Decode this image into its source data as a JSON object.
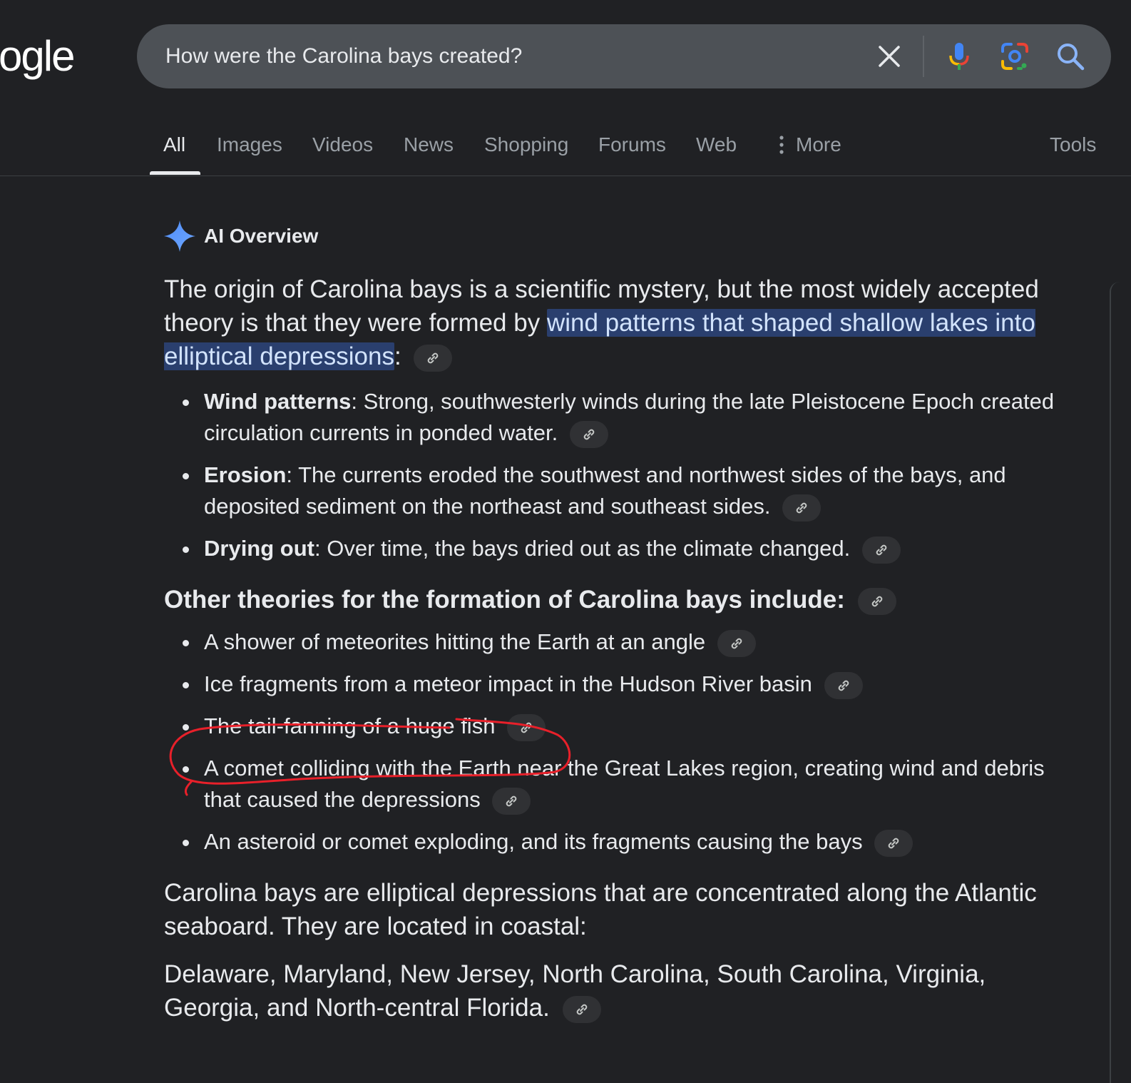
{
  "logo": {
    "text": "ogle"
  },
  "search": {
    "query": "How were the Carolina bays created?"
  },
  "tabs": [
    {
      "label": "All"
    },
    {
      "label": "Images"
    },
    {
      "label": "Videos"
    },
    {
      "label": "News"
    },
    {
      "label": "Shopping"
    },
    {
      "label": "Forums"
    },
    {
      "label": "Web"
    },
    {
      "label": "More"
    }
  ],
  "tools_label": "Tools",
  "ai_overview": {
    "title": "AI Overview",
    "intro_before": "The origin of Carolina bays is a scientific mystery, but the most widely accepted theory is that they were formed by ",
    "intro_highlight": "wind patterns that shaped shallow lakes into elliptical depressions",
    "intro_after": ":",
    "main_bullets": [
      {
        "term": "Wind patterns",
        "text": ": Strong, southwesterly winds during the late Pleistocene Epoch created circulation currents in ponded water."
      },
      {
        "term": "Erosion",
        "text": ": The currents eroded the southwest and northwest sides of the bays, and deposited sediment on the northeast and southeast sides."
      },
      {
        "term": "Drying out",
        "text": ": Over time, the bays dried out as the climate changed."
      }
    ],
    "other_heading": "Other theories for the formation of Carolina bays include:",
    "other_bullets": [
      "A shower of meteorites hitting the Earth at an angle",
      "Ice fragments from a meteor impact in the Hudson River basin",
      "The tail-fanning of a huge fish",
      "A comet colliding with the Earth near the Great Lakes region, creating wind and debris that caused the depressions",
      "An asteroid or comet exploding, and its fragments causing the bays"
    ],
    "location_para": "Carolina bays are elliptical depressions that are concentrated along the Atlantic seaboard. They are located in coastal:",
    "states_para": "Delaware, Maryland, New Jersey, North Carolina, South Carolina, Virginia, Georgia, and North-central Florida."
  },
  "colors": {
    "background": "#202124",
    "searchbar": "#4d5156",
    "highlight": "#2a3f6e",
    "annotation": "#e8202a"
  },
  "icons": [
    "clear-icon",
    "microphone-icon",
    "lens-icon",
    "search-icon",
    "link-icon",
    "sparkle-icon",
    "more-vert-icon"
  ]
}
